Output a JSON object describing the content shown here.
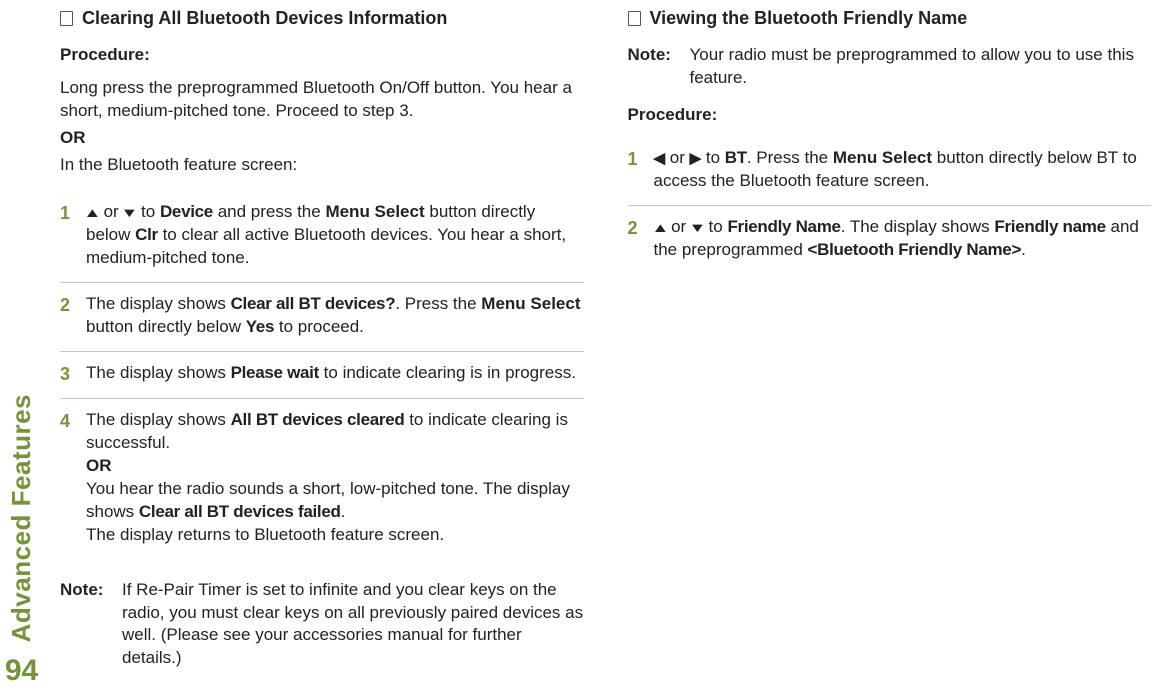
{
  "sidebar": {
    "section_title": "Advanced Features",
    "page_number": "94"
  },
  "left": {
    "title": "Clearing All Bluetooth Devices Information",
    "procedure_label": "Procedure:",
    "intro_1": "Long press the preprogrammed Bluetooth On/Off button. You hear a short, medium-pitched tone. Proceed to step 3.",
    "intro_or": "OR",
    "intro_2": "In the Bluetooth feature screen:",
    "steps": {
      "s1": {
        "num": "1",
        "t1": " or ",
        "t2": " to ",
        "device": "Device",
        "t3": " and press the ",
        "menu_select": "Menu Select",
        "t4": " button directly below ",
        "clr": "Clr",
        "t5": " to clear all active Bluetooth devices. You hear a short, medium-pitched tone."
      },
      "s2": {
        "num": "2",
        "t1": "The display shows ",
        "msg1": "Clear all BT devices?",
        "t2": ". Press the ",
        "menu_select": "Menu Select",
        "t3": " button directly below ",
        "yes": "Yes",
        "t4": " to proceed."
      },
      "s3": {
        "num": "3",
        "t1": "The display shows ",
        "msg1": "Please wait",
        "t2": " to indicate clearing is in progress."
      },
      "s4": {
        "num": "4",
        "t1": "The display shows ",
        "msg1": "All BT devices cleared",
        "t2": " to indicate clearing is successful.",
        "or": "OR",
        "t3": "You hear the radio sounds a short, low-pitched tone. The display shows ",
        "msg2": "Clear all BT devices failed",
        "t4": ".",
        "t5": "The display returns to Bluetooth feature screen."
      }
    },
    "note_label": "Note:",
    "note_body": "If Re-Pair Timer is set to infinite and you clear keys on the radio, you must clear keys on all previously paired devices as well. (Please see your accessories manual for further details.)"
  },
  "right": {
    "title": "Viewing the Bluetooth Friendly Name",
    "note_label": "Note:",
    "note_body": "Your radio must be preprogrammed to allow you to use this feature.",
    "procedure_label": "Procedure:",
    "steps": {
      "s1": {
        "num": "1",
        "t1": " or ",
        "t2": " to ",
        "bt": "BT",
        "t3": ". Press the ",
        "menu_select": "Menu Select",
        "t4": " button directly below BT to access the Bluetooth feature screen."
      },
      "s2": {
        "num": "2",
        "t1": " or ",
        "t2": " to ",
        "fn": "Friendly Name",
        "t3": ". The display shows ",
        "fn2": "Friendly name",
        "t4": " and the preprogrammed  ",
        "fn3": "<Bluetooth Friendly Name>",
        "t5": "."
      }
    }
  },
  "glyphs": {
    "up": "▲",
    "down": "▼",
    "left": "◀",
    "right": "▶"
  }
}
